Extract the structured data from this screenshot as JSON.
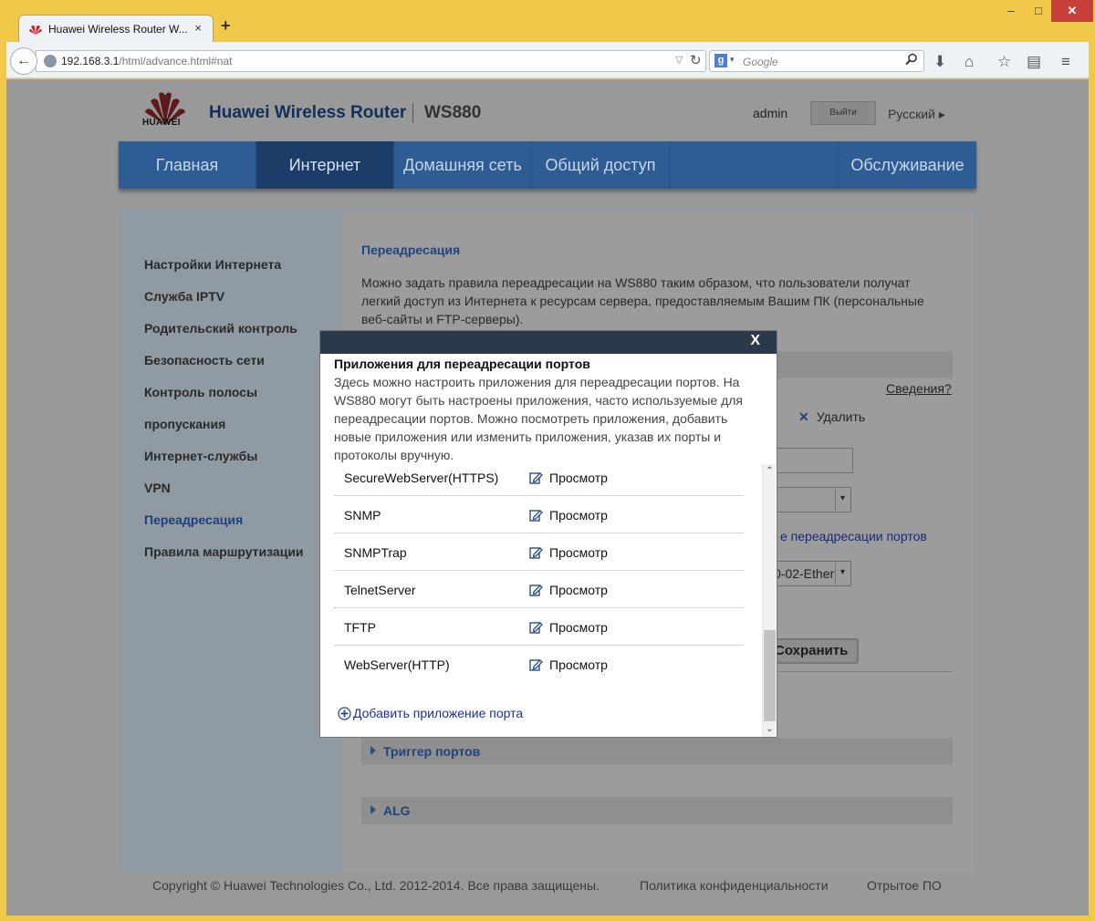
{
  "browser": {
    "tab_title": "Huawei Wireless Router W...",
    "tab_close": "×",
    "new_tab": "+",
    "window_min": "–",
    "window_max": "□",
    "window_close": "✕",
    "url_host": "192.168.3.1",
    "url_path": "/html/advance.html#nat",
    "search_placeholder": "Google",
    "search_engine_letter": "g"
  },
  "header": {
    "logo_text": "HUAWEI",
    "product": "Huawei Wireless Router",
    "model": "WS880",
    "user": "admin",
    "logout": "Выйти",
    "language": "Русский ▸"
  },
  "nav": {
    "items": [
      {
        "label": "Главная"
      },
      {
        "label": "Интернет"
      },
      {
        "label": "Домашняя сеть"
      },
      {
        "label": "Общий доступ"
      },
      {
        "label": "Обслуживание"
      }
    ],
    "active_index": 1
  },
  "sidebar": {
    "items": [
      {
        "label": "Настройки Интернета"
      },
      {
        "label": "Служба IPTV"
      },
      {
        "label": "Родительский контроль"
      },
      {
        "label": "Безопасность сети"
      },
      {
        "label": "Контроль полосы"
      },
      {
        "label": "пропускания"
      },
      {
        "label": "Интернет-службы"
      },
      {
        "label": "VPN"
      },
      {
        "label": "Переадресация"
      },
      {
        "label": "Правила маршрутизации"
      }
    ],
    "active_index": 8
  },
  "main": {
    "section_title": "Переадресация",
    "section_desc": "Можно задать правила переадресации на WS880 таким образом, что пользователи получат легкий доступ из Интернета к ресурсам сервера, предоставляемым Вашим ПК (персональные веб-сайты и FTP-серверы).",
    "details_link": "Сведения?",
    "delete_label": "Удалить",
    "delete_x": "✕",
    "link_partial": "е переадресации портов",
    "iface_partial": "0-02-Ether",
    "save_partial": "Сохранить",
    "trigger_label": "Триггер портов",
    "alg_label": "ALG"
  },
  "footer": {
    "copyright": "Copyright © Huawei Technologies Co., Ltd. 2012-2014. Все права защищены.",
    "privacy": "Политика конфиденциальности",
    "open_source": "Отрытое ПО"
  },
  "modal": {
    "close": "X",
    "title": "Приложения для переадресации портов",
    "desc": "Здесь можно настроить приложения для переадресации портов. На WS880 могут быть настроены приложения, часто используемые для переадресации портов. Можно посмотреть приложения, добавить новые приложения или изменить приложения, указав их порты и протоколы вручную.",
    "view_label": "Просмотр",
    "apps": [
      {
        "name": "SecureWebServer(HTTPS)"
      },
      {
        "name": "SNMP"
      },
      {
        "name": "SNMPTrap"
      },
      {
        "name": "TelnetServer"
      },
      {
        "name": "TFTP"
      },
      {
        "name": "WebServer(HTTP)"
      }
    ],
    "add_app": "Добавить приложение порта",
    "scroll_up": "⌃",
    "scroll_down": "⌄"
  },
  "colors": {
    "nav_bg": "#2d5d94",
    "nav_active": "#1b3d68",
    "link_blue": "#1a30a0",
    "modal_header": "#2b3a4b",
    "firefox_frame": "#f0c94a"
  }
}
